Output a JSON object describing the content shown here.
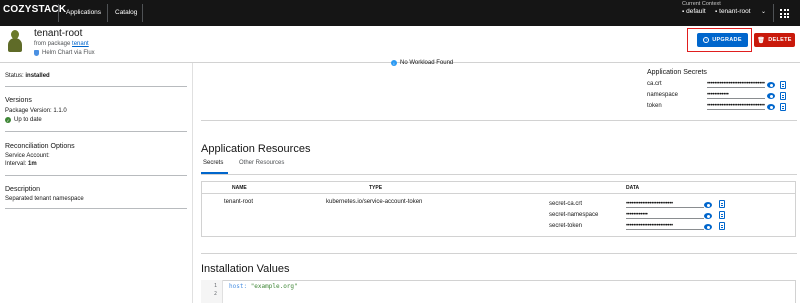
{
  "header": {
    "logo": "COZYSTACK",
    "nav": [
      "Applications",
      "Catalog"
    ],
    "context_label": "Current Context",
    "context_namespace": "default",
    "context_tenant": "tenant-root"
  },
  "title": {
    "name": "tenant-root",
    "from_package_prefix": "from package",
    "from_package_link": "tenant",
    "helm_text": "Helm Chart via Flux"
  },
  "actions": {
    "upgrade": "UPGRADE",
    "delete": "DELETE"
  },
  "sidebar": {
    "status_label": "Status:",
    "status_value": "installed",
    "versions_heading": "Versions",
    "package_version_label": "Package Version:",
    "package_version_value": "1.1.0",
    "up_to_date": "Up to date",
    "reconciliation_heading": "Reconciliation Options",
    "service_account_label": "Service Account:",
    "interval_label": "Interval:",
    "interval_value": "1m",
    "description_heading": "Description",
    "description_value": "Separated tenant namespace"
  },
  "workload": {
    "message": "No Workload Found"
  },
  "app_secrets": {
    "title": "Application Secrets",
    "items": [
      {
        "key": "ca.crt",
        "value": "••••••••••••••••••••••••••••••••"
      },
      {
        "key": "namespace",
        "value": "••••••••••••"
      },
      {
        "key": "token",
        "value": "••••••••••••••••••••••••••••••••"
      }
    ]
  },
  "resources": {
    "title": "Application Resources",
    "tabs": [
      "Secrets",
      "Other Resources"
    ],
    "columns": [
      "NAME",
      "TYPE",
      "DATA"
    ],
    "row": {
      "name": "tenant-root",
      "type": "kubernetes.io/service-account-token",
      "data": [
        {
          "key": "secret-ca.crt",
          "value": "••••••••••••••••••••••••••"
        },
        {
          "key": "secret-namespace",
          "value": "••••••••••••"
        },
        {
          "key": "secret-token",
          "value": "••••••••••••••••••••••••••"
        }
      ]
    }
  },
  "install": {
    "title": "Installation Values",
    "lines": [
      "1",
      "2"
    ],
    "code_key": "host:",
    "code_value": "\"example.org\""
  },
  "colors": {
    "header_bg": "#151515",
    "primary": "#0066cc",
    "danger": "#c9190b",
    "success": "#3e8635",
    "highlight": "#e01e1e"
  }
}
